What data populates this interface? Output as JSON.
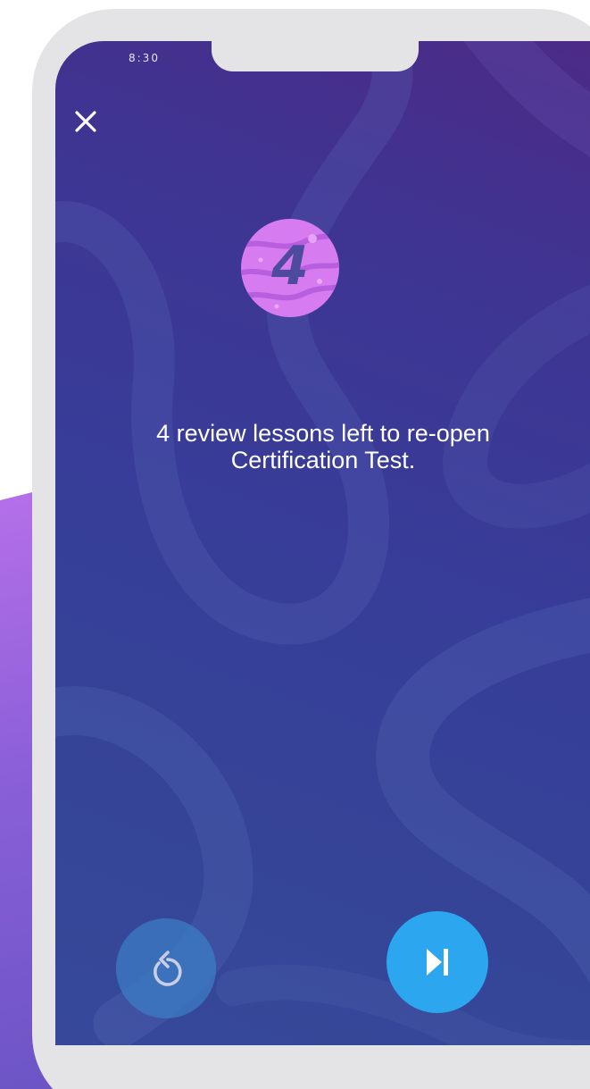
{
  "status_bar": {
    "time": "8:30"
  },
  "top_bar": {
    "close_icon": "close-icon"
  },
  "badge": {
    "number": "4",
    "icon": "planet-badge-icon",
    "color": "#d77bf0"
  },
  "message": {
    "line1": "4 review lessons left to re-open",
    "line2": "Certification Test."
  },
  "controls": {
    "restart_icon": "restart-icon",
    "skip_icon": "skip-next-icon",
    "skip_color": "#2ba6ef",
    "restart_color": "#3c7ec6"
  },
  "colors": {
    "screen_top": "#4d2a86",
    "screen_bottom": "#37499a",
    "text": "#ffffff",
    "phone_frame": "#e4e4e6"
  }
}
